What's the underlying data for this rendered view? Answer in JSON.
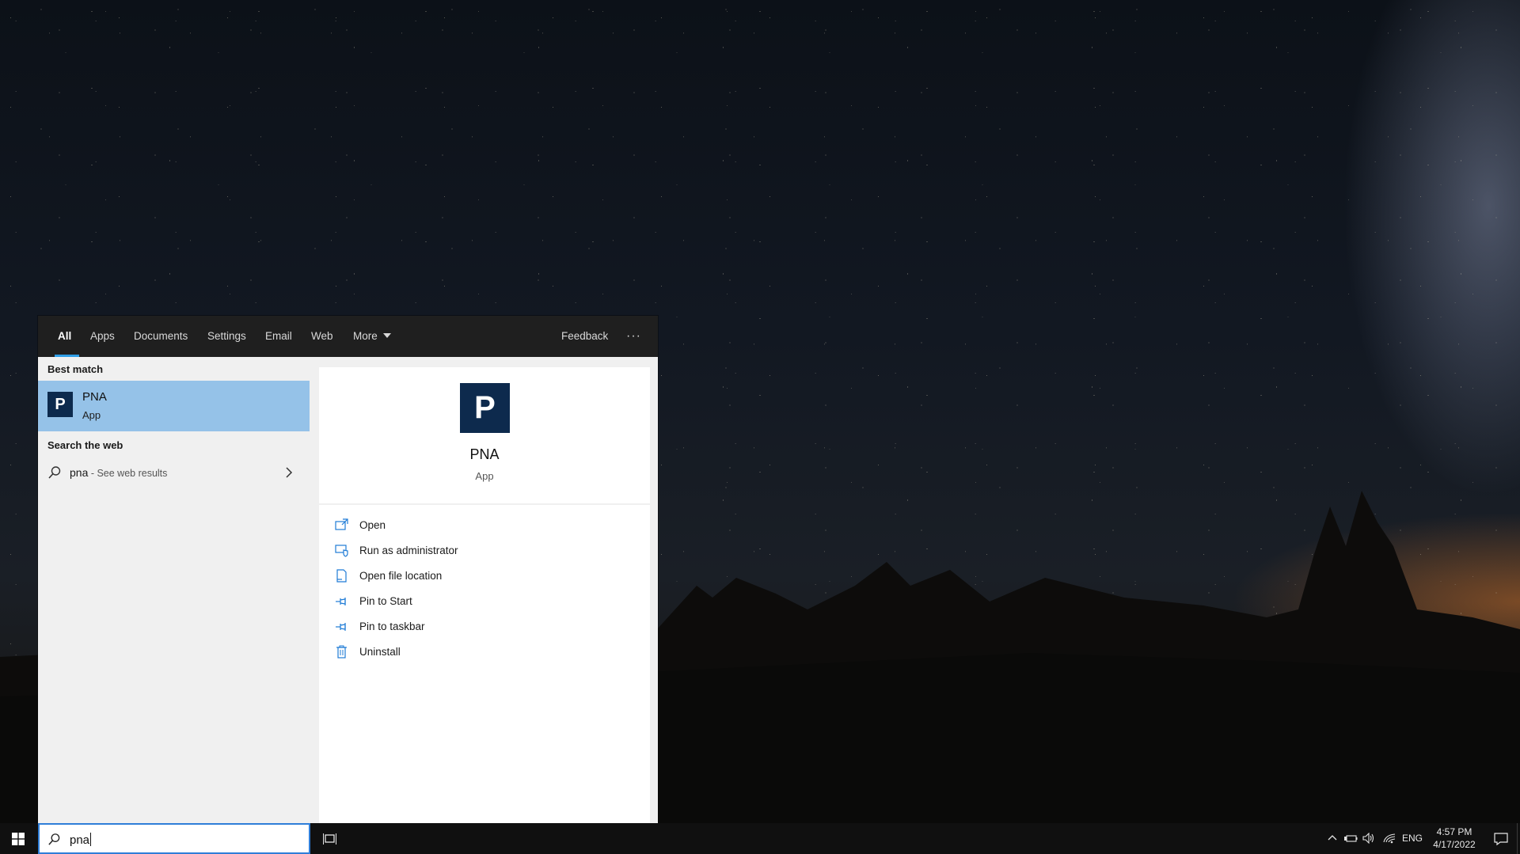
{
  "flyout": {
    "tabs": [
      {
        "label": "All",
        "active": true
      },
      {
        "label": "Apps"
      },
      {
        "label": "Documents"
      },
      {
        "label": "Settings"
      },
      {
        "label": "Email"
      },
      {
        "label": "Web"
      },
      {
        "label": "More"
      }
    ],
    "feedback_label": "Feedback",
    "more_options": "···",
    "accent_color": "#2f9ee6"
  },
  "results": {
    "best_match_heading": "Best match",
    "best_match": {
      "icon_letter": "P",
      "name": "PNA",
      "type": "App"
    },
    "web_heading": "Search the web",
    "web_result": {
      "query": "pna",
      "suffix": " - See web results"
    }
  },
  "preview": {
    "icon_letter": "P",
    "name": "PNA",
    "type": "App",
    "actions": [
      {
        "label": "Open",
        "icon": "open-window-icon"
      },
      {
        "label": "Run as administrator",
        "icon": "shield-window-icon"
      },
      {
        "label": "Open file location",
        "icon": "file-location-icon"
      },
      {
        "label": "Pin to Start",
        "icon": "pin-icon"
      },
      {
        "label": "Pin to taskbar",
        "icon": "pin-icon"
      },
      {
        "label": "Uninstall",
        "icon": "trash-icon"
      }
    ]
  },
  "taskbar": {
    "search_value": "pna",
    "language": "ENG",
    "time": "4:57 PM",
    "date": "4/17/2022"
  }
}
